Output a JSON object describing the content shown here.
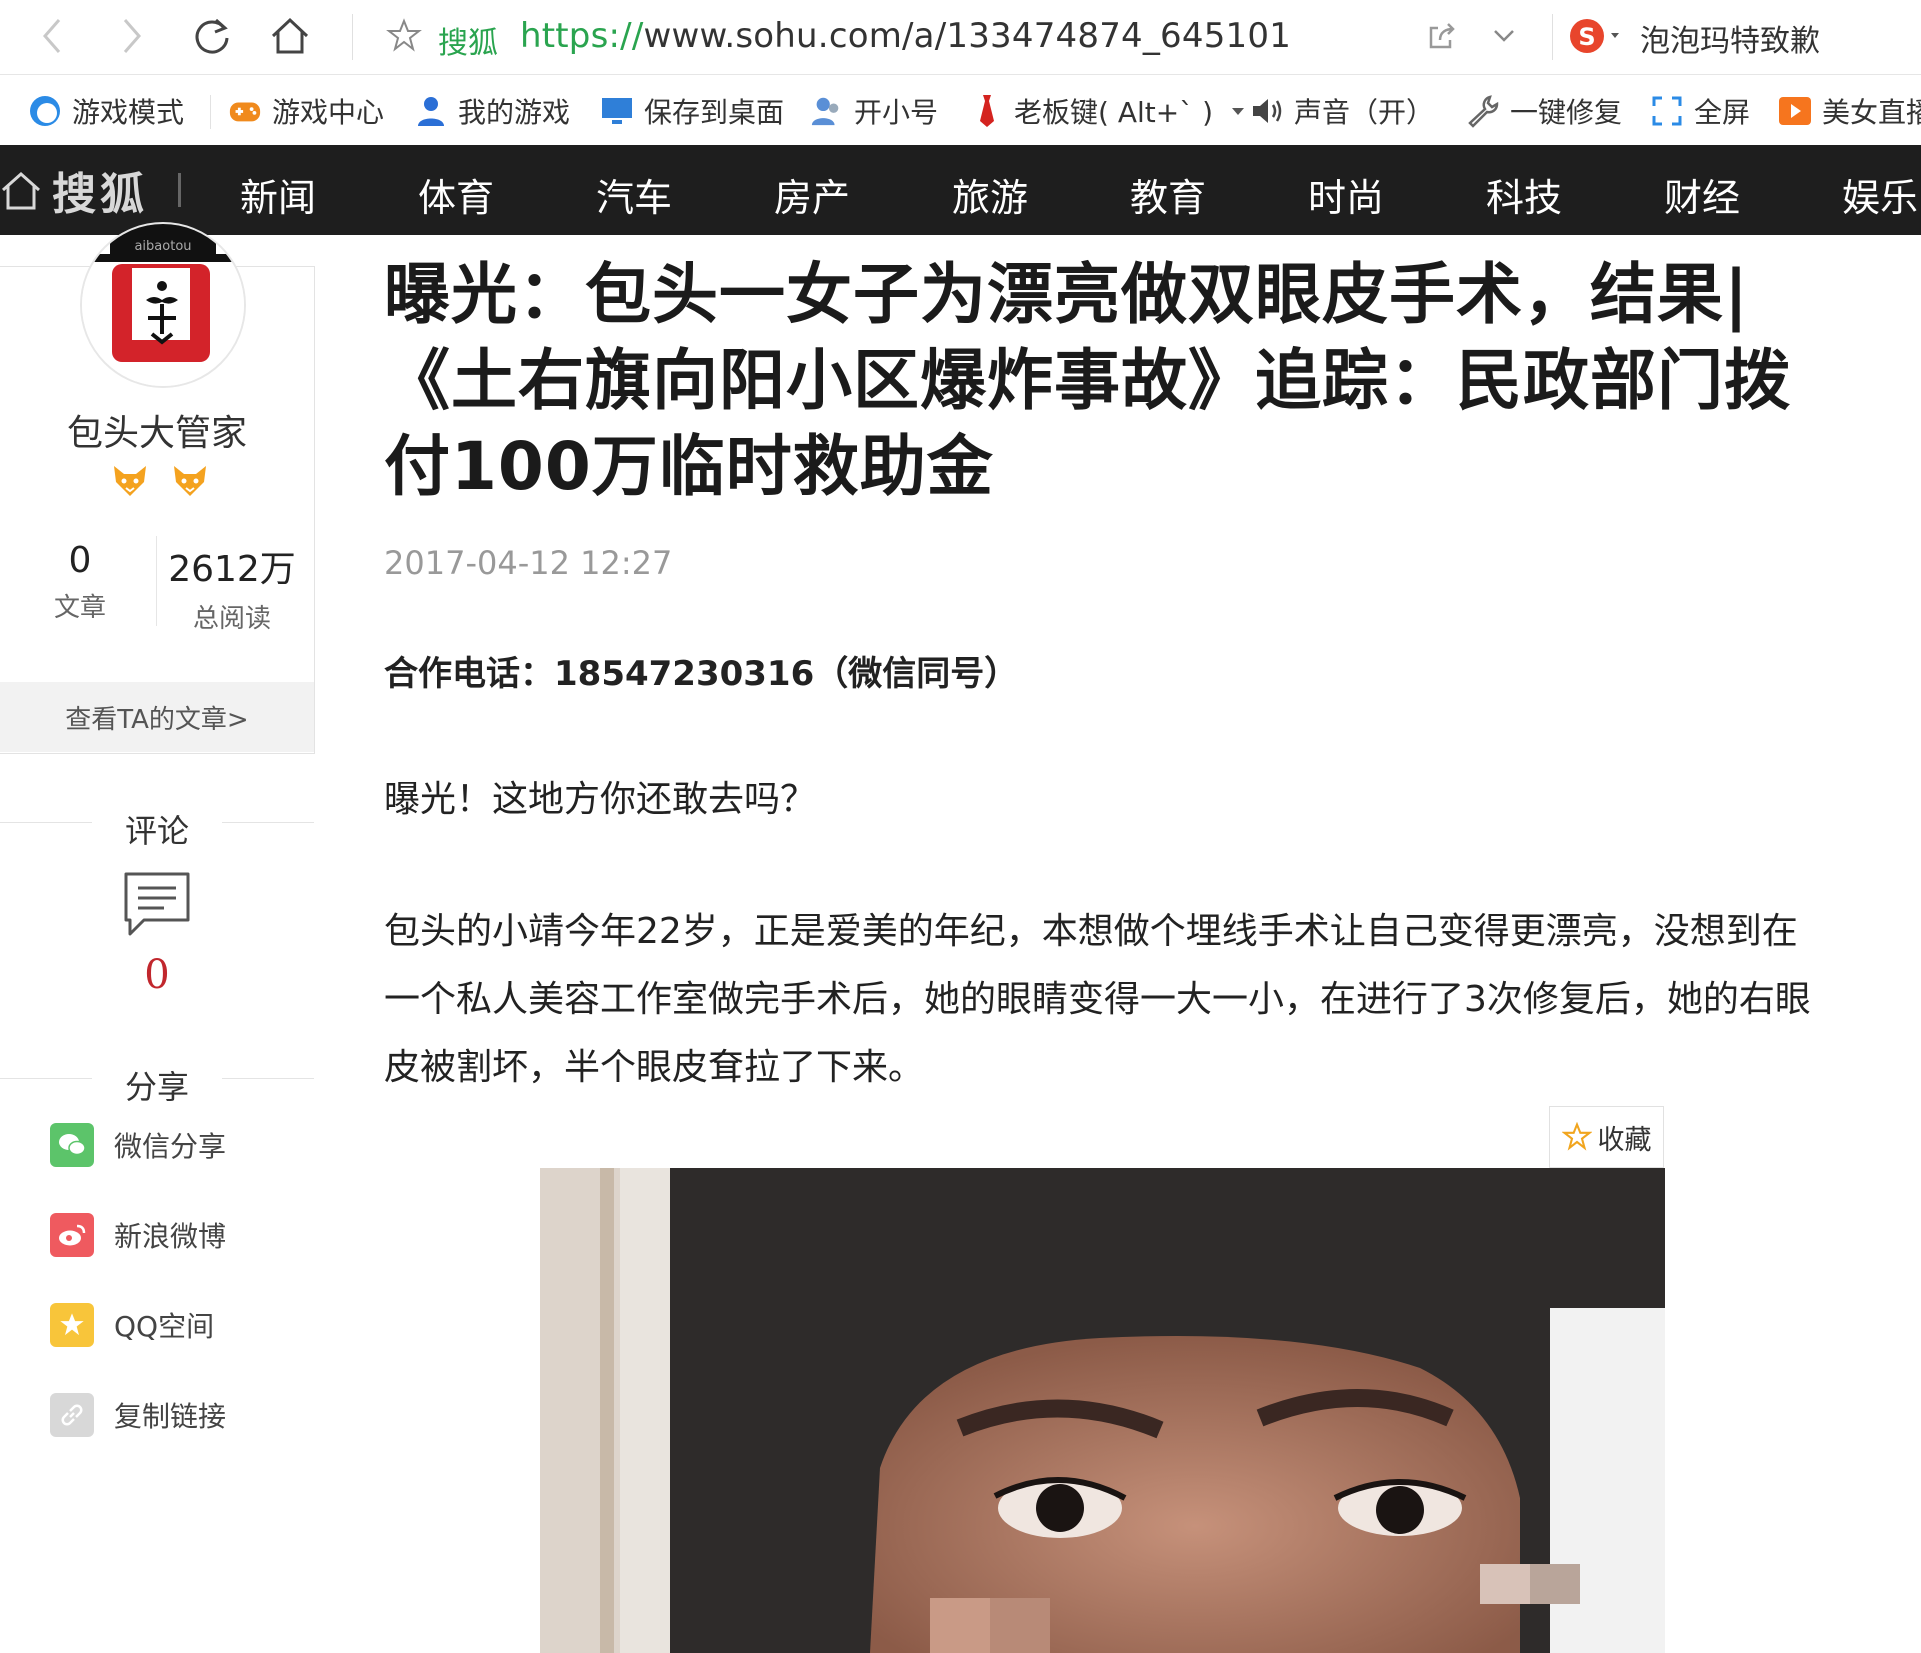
{
  "browser": {
    "site_tag": "搜狐",
    "url_proto": "https://",
    "url_rest": "www.sohu.com/a/133474874_645101",
    "news_ticker": "泡泡玛特致歉"
  },
  "toolbar": {
    "items": [
      {
        "label": "游戏模式"
      },
      {
        "label": "游戏中心"
      },
      {
        "label": "我的游戏"
      },
      {
        "label": "保存到桌面"
      },
      {
        "label": "开小号"
      },
      {
        "label": "老板键( Alt+` )"
      },
      {
        "label": "声音（开）"
      },
      {
        "label": "一键修复"
      },
      {
        "label": "全屏"
      },
      {
        "label": "美女直播"
      }
    ]
  },
  "sohu_nav": {
    "logo": "搜狐",
    "links": [
      "新闻",
      "体育",
      "汽车",
      "房产",
      "旅游",
      "教育",
      "时尚",
      "科技",
      "财经",
      "娱乐"
    ]
  },
  "author": {
    "avatar_text": "aibaotou",
    "name": "包头大管家",
    "articles_count": "0",
    "articles_label": "文章",
    "reads_count": "2612万",
    "reads_label": "总阅读",
    "view_link": "查看TA的文章>"
  },
  "comments": {
    "title": "评论",
    "count": "0"
  },
  "share": {
    "title": "分享",
    "items": [
      {
        "label": "微信分享",
        "color": "#5cc46a"
      },
      {
        "label": "新浪微博",
        "color": "#ef5a5f"
      },
      {
        "label": "QQ空间",
        "color": "#f8c53a"
      },
      {
        "label": "复制链接",
        "color": "#d8d8d8"
      }
    ]
  },
  "article": {
    "title": "曝光：包头一女子为漂亮做双眼皮手术，结果|《土右旗向阳小区爆炸事故》追踪：民政部门拨付100万临时救助金",
    "date": "2017-04-12 12:27",
    "contact": "合作电话：18547230316（微信同号）",
    "para1": "曝光！这地方你还敢去吗？",
    "para2": "包头的小靖今年22岁，正是爱美的年纪，本想做个埋线手术让自己变得更漂亮，没想到在一个私人美容工作室做完手术后，她的眼睛变得一大一小，在进行了3次修复后，她的右眼皮被割坏，半个眼皮耷拉了下来。",
    "collect_label": "收藏"
  },
  "colors": {
    "nav_bg": "#1e1e1e",
    "green": "#2aa44f",
    "red": "#c1272d"
  }
}
